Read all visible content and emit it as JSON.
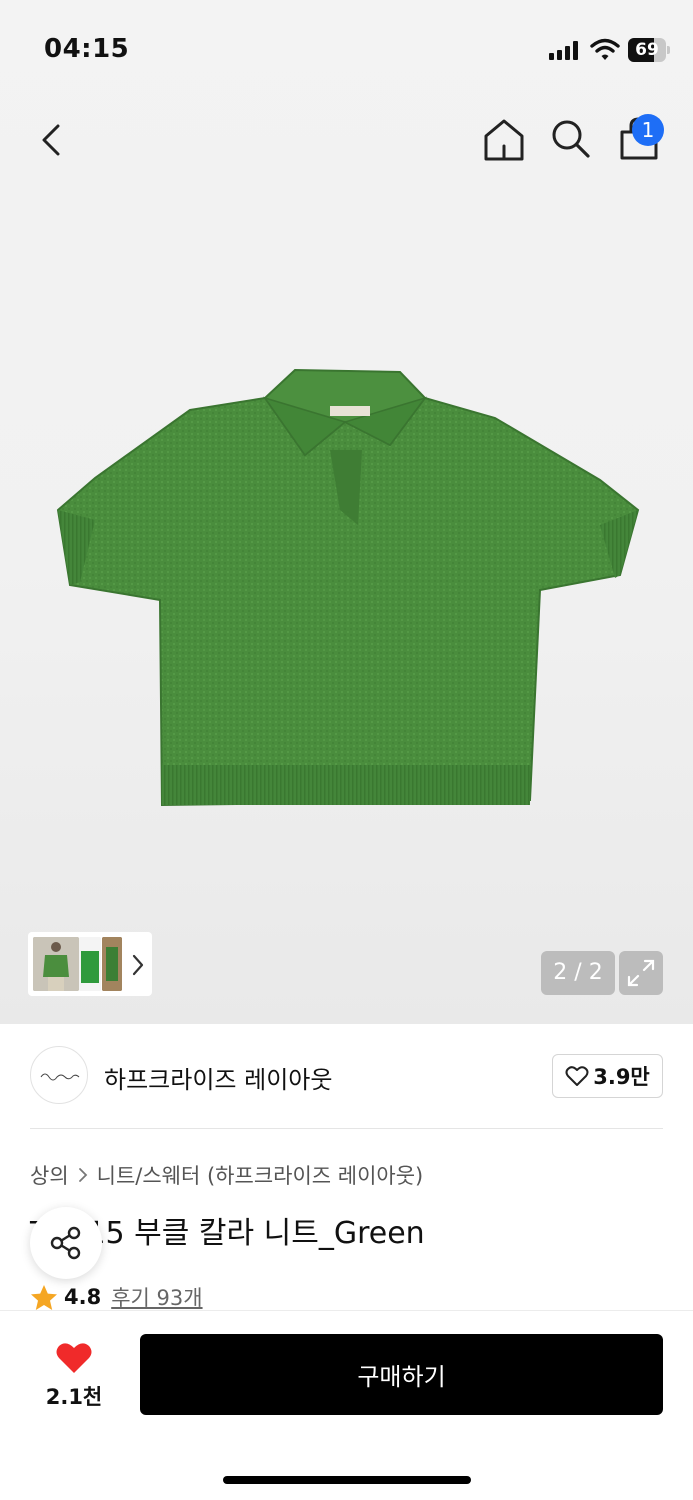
{
  "status_bar": {
    "time": "04:15",
    "battery": "69",
    "battery_level": 0.69
  },
  "nav": {
    "back_icon": "chevron-left-icon",
    "home_icon": "home-icon",
    "search_icon": "search-icon",
    "cart_icon": "shopping-bag-icon",
    "cart_badge": "1",
    "badge_color": "#1e6ef6"
  },
  "gallery": {
    "page_indicator": "2 / 2",
    "expand_icon": "expand-icon",
    "product_color": "#4b8e3e"
  },
  "brand": {
    "name": "하프크라이즈 레이아웃",
    "likes": "3.9만"
  },
  "product": {
    "breadcrumb": [
      "상의",
      "니트/스웨터 (하프크라이즈 레이아웃)"
    ],
    "title": "TS015 부클 칼라 니트_Green",
    "rating": "4.8",
    "reviews": "후기 93개"
  },
  "bottom_bar": {
    "wish_count": "2.1천",
    "buy_label": "구매하기",
    "heart_color": "#f02a2a"
  }
}
